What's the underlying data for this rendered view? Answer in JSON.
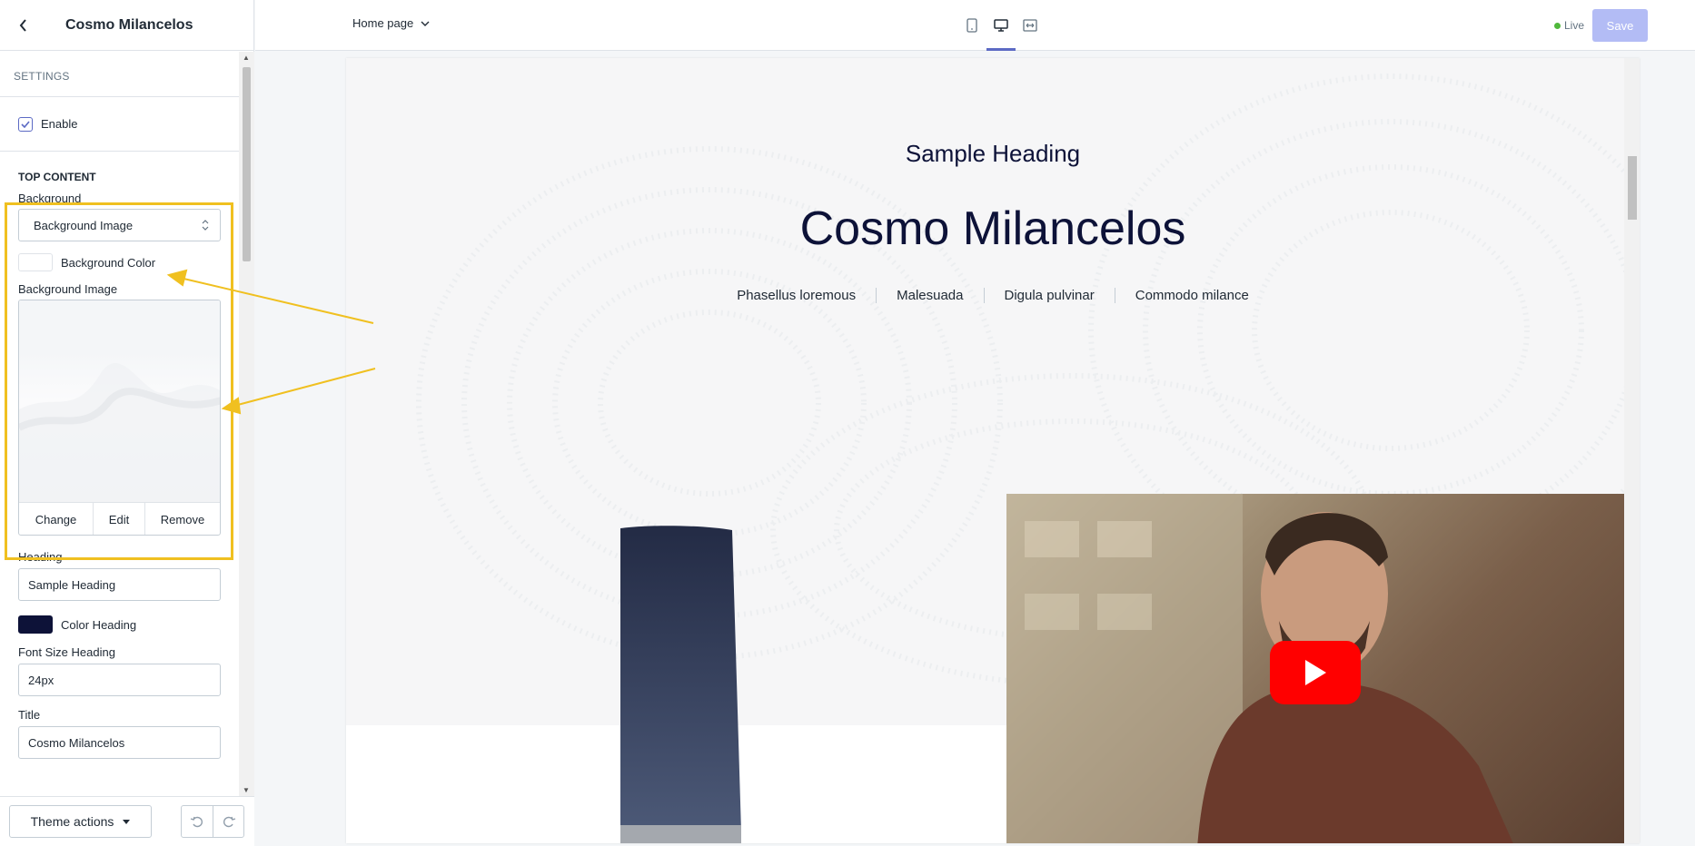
{
  "sidebar": {
    "title": "Cosmo Milancelos",
    "settings_label": "SETTINGS",
    "enable_label": "Enable",
    "top_content_label": "TOP CONTENT",
    "background_label": "Background",
    "background_select": "Background Image",
    "background_color_label": "Background Color",
    "background_image_label": "Background Image",
    "image_actions": [
      "Change",
      "Edit",
      "Remove"
    ],
    "heading_label": "Heading",
    "heading_value": "Sample Heading",
    "color_heading_label": "Color Heading",
    "color_heading_value": "#0d1238",
    "font_size_heading_label": "Font Size Heading",
    "font_size_heading_value": "24px",
    "title_label": "Title",
    "title_value": "Cosmo Milancelos",
    "theme_actions_label": "Theme actions"
  },
  "topbar": {
    "page_select": "Home page",
    "live_label": "Live",
    "save_label": "Save"
  },
  "preview": {
    "sample_heading": "Sample Heading",
    "title": "Cosmo Milancelos",
    "links": [
      "Phasellus loremous",
      "Malesuada",
      "Digula pulvinar",
      "Commodo milance"
    ]
  },
  "colors": {
    "accent": "#5c6ac4",
    "highlight": "#f0c020",
    "live": "#50b83c",
    "save_disabled": "#b3bcf5",
    "youtube": "#ff0000"
  }
}
